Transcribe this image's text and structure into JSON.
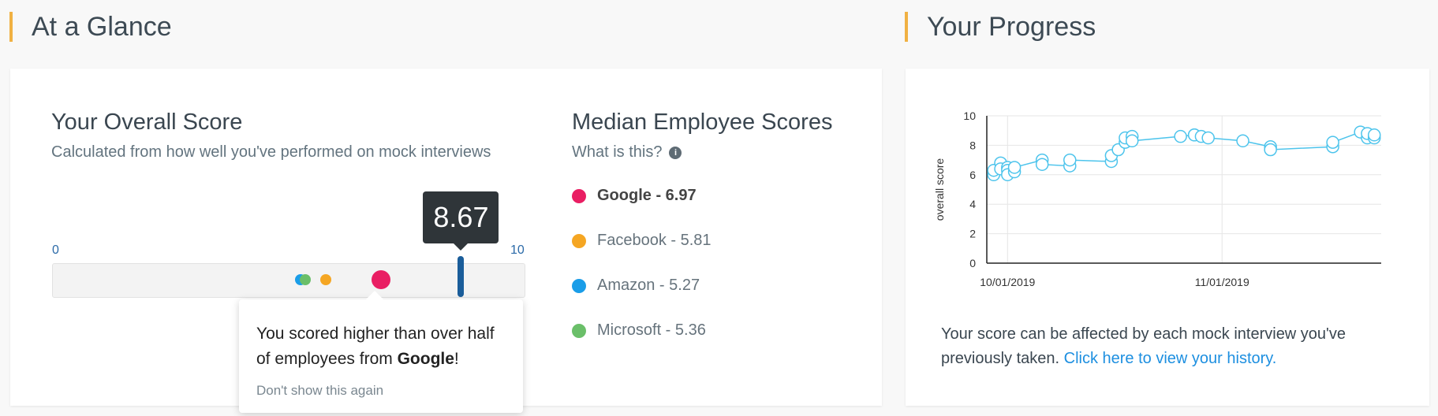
{
  "colors": {
    "accent": "#f0b143",
    "google": "#e91e63",
    "facebook": "#f5a623",
    "amazon": "#1a9de8",
    "microsoft": "#6abf69",
    "marker": "#1a5d9a",
    "chart_line": "#4dc4ec",
    "link": "#1d8fe0"
  },
  "glance": {
    "title": "At a Glance",
    "score_title": "Your Overall Score",
    "score_subtitle": "Calculated from how well you've performed on mock interviews",
    "scale_min": "0",
    "scale_max": "10",
    "score_value": "8.67",
    "score_fraction": 0.867,
    "company_dots": [
      {
        "company": "Amazon",
        "score": 5.27,
        "color": "#1a9de8"
      },
      {
        "company": "Microsoft",
        "score": 5.36,
        "color": "#6abf69"
      },
      {
        "company": "Facebook",
        "score": 5.81,
        "color": "#f5a623"
      },
      {
        "company": "Google",
        "score": 6.97,
        "color": "#e91e63"
      }
    ],
    "popover": {
      "text_before": "You scored higher than over half of employees from ",
      "company": "Google",
      "text_after": "!",
      "dismiss": "Don't show this again"
    },
    "median_title": "Median Employee Scores",
    "median_subtitle": "What is this?",
    "info_icon": "info-icon",
    "legend": [
      {
        "label": "Google - 6.97",
        "color": "#e91e63",
        "bold": true
      },
      {
        "label": "Facebook - 5.81",
        "color": "#f5a623",
        "bold": false
      },
      {
        "label": "Amazon - 5.27",
        "color": "#1a9de8",
        "bold": false
      },
      {
        "label": "Microsoft - 5.36",
        "color": "#6abf69",
        "bold": false
      }
    ]
  },
  "progress": {
    "title": "Your Progress",
    "text": "Your score can be affected by each mock interview you've previously taken. ",
    "link": "Click here to view your history."
  },
  "chart_data": {
    "type": "line",
    "ylabel": "overall score",
    "xlabel": "",
    "ylim": [
      0,
      10
    ],
    "yticks": [
      "0",
      "2",
      "4",
      "6",
      "8",
      "10"
    ],
    "xticks": [
      "10/01/2019",
      "11/01/2019"
    ],
    "grid": true,
    "series": [
      {
        "x": [
          "2019-09-29",
          "2019-09-29",
          "2019-09-30",
          "2019-09-30",
          "2019-10-01",
          "2019-10-01",
          "2019-10-01",
          "2019-10-02",
          "2019-10-02",
          "2019-10-06",
          "2019-10-06",
          "2019-10-10",
          "2019-10-10",
          "2019-10-16",
          "2019-10-16",
          "2019-10-17",
          "2019-10-18",
          "2019-10-18",
          "2019-10-19",
          "2019-10-19",
          "2019-10-26",
          "2019-10-28",
          "2019-10-28",
          "2019-10-29",
          "2019-10-30",
          "2019-11-04",
          "2019-11-08",
          "2019-11-08",
          "2019-11-17",
          "2019-11-17",
          "2019-11-21",
          "2019-11-22",
          "2019-11-22",
          "2019-11-23",
          "2019-11-23"
        ],
        "y": [
          6.0,
          6.3,
          6.8,
          6.4,
          6.5,
          6.3,
          6.0,
          6.2,
          6.5,
          7.0,
          6.7,
          6.6,
          7.0,
          6.9,
          7.3,
          7.7,
          8.2,
          8.5,
          8.6,
          8.3,
          8.6,
          8.7,
          8.7,
          8.6,
          8.5,
          8.3,
          7.9,
          7.7,
          7.9,
          8.2,
          8.9,
          8.5,
          8.8,
          8.5,
          8.7
        ]
      }
    ]
  }
}
